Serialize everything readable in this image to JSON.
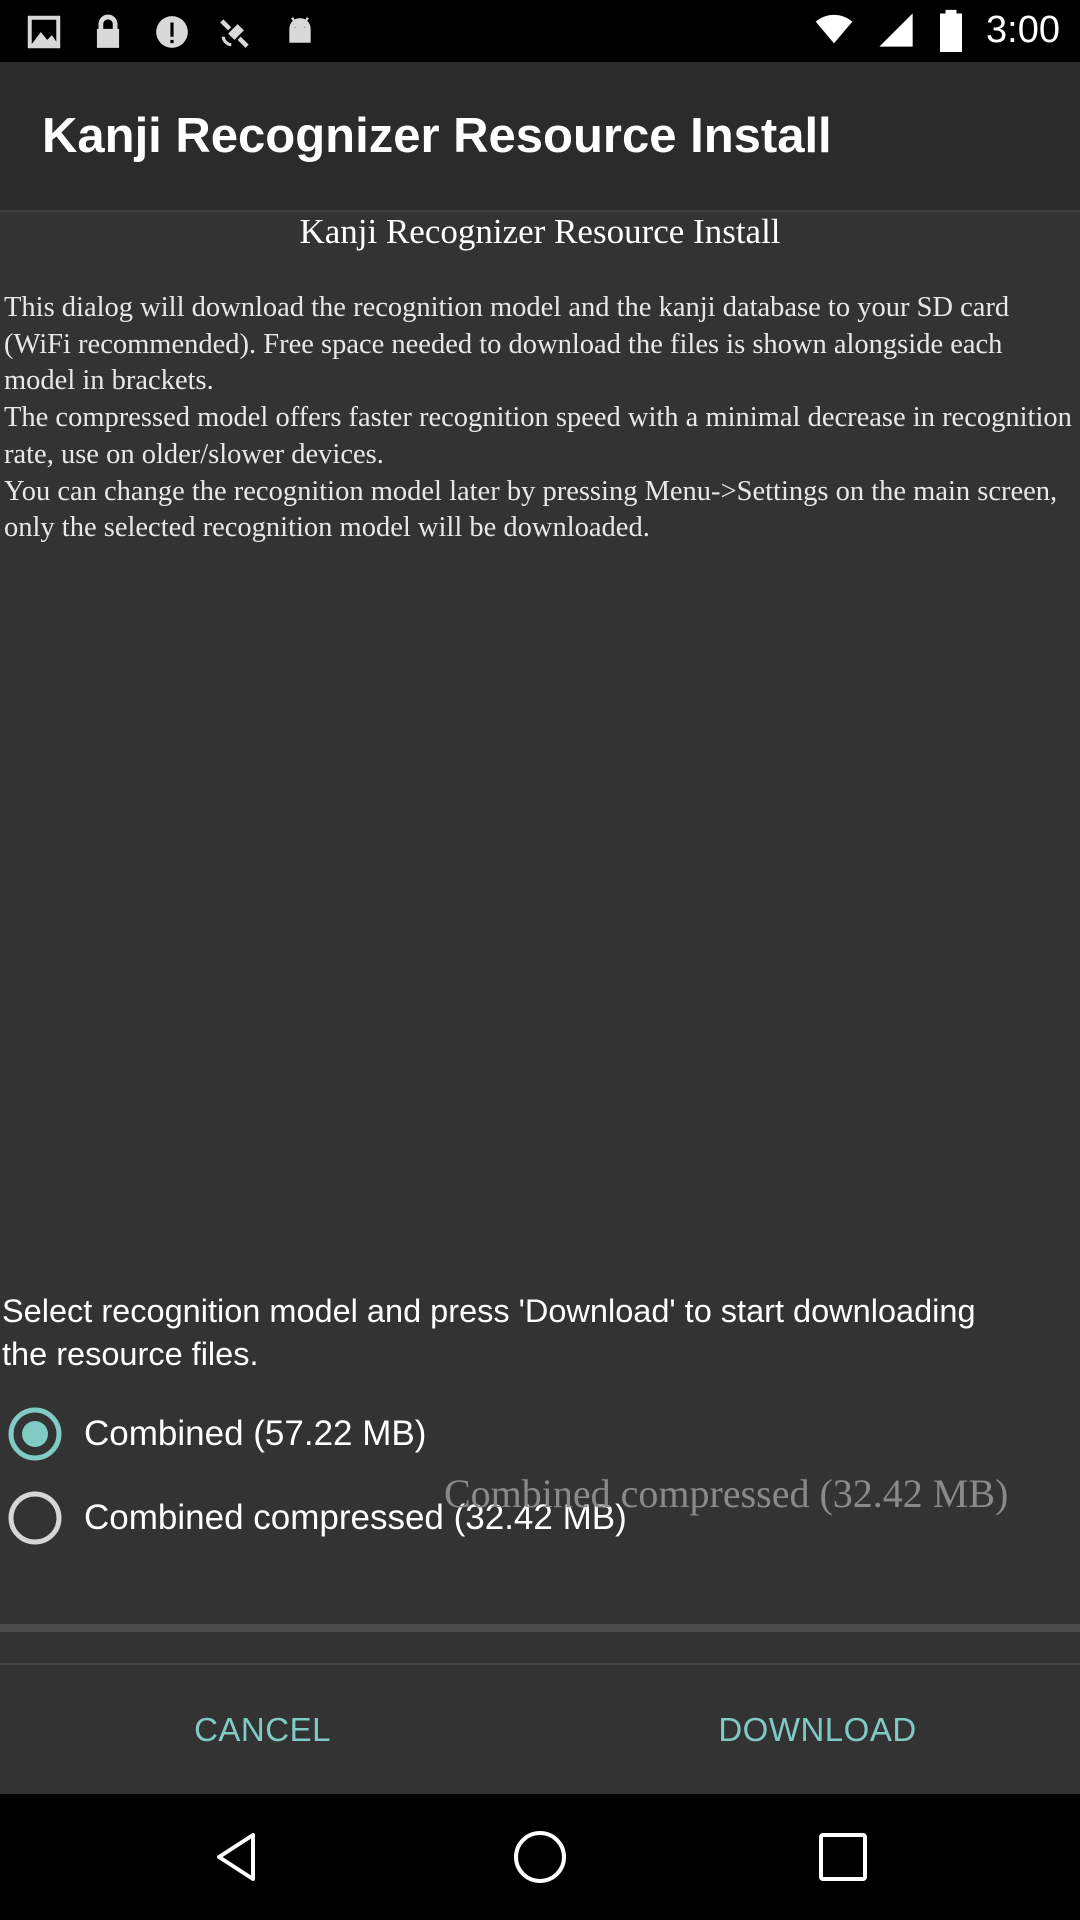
{
  "status_bar": {
    "time": "3:00",
    "left_icons": [
      "image-icon",
      "lock-icon",
      "alert-icon",
      "satellite-icon",
      "android-icon"
    ],
    "right_icons": [
      "wifi-icon",
      "cellular-icon",
      "battery-icon"
    ]
  },
  "dialog": {
    "title": "Kanji Recognizer Resource Install",
    "subtitle": "Kanji Recognizer Resource Install",
    "description": "This dialog will download the recognition model and the kanji database to your SD card (WiFi recommended). Free space needed to download the files is shown alongside each model in brackets.\n The compressed model offers faster recognition speed with a minimal decrease in recognition rate, use on older/slower devices.\n You can change the recognition model later by pressing Menu->Settings on the main screen, only the selected recognition model will be downloaded.",
    "instruction": "Select recognition model and press 'Download' to start downloading the resource files.",
    "options": [
      {
        "label": "Combined (57.22 MB)",
        "selected": true
      },
      {
        "label": "Combined compressed (32.42 MB)",
        "selected": false
      }
    ],
    "ghost_label": "Combined compressed (32.42 MB)",
    "accent_color": "#80cbc4",
    "buttons": {
      "cancel": "CANCEL",
      "download": "DOWNLOAD"
    }
  },
  "nav_bar": {
    "icons": [
      "back-icon",
      "home-icon",
      "recents-icon"
    ]
  }
}
